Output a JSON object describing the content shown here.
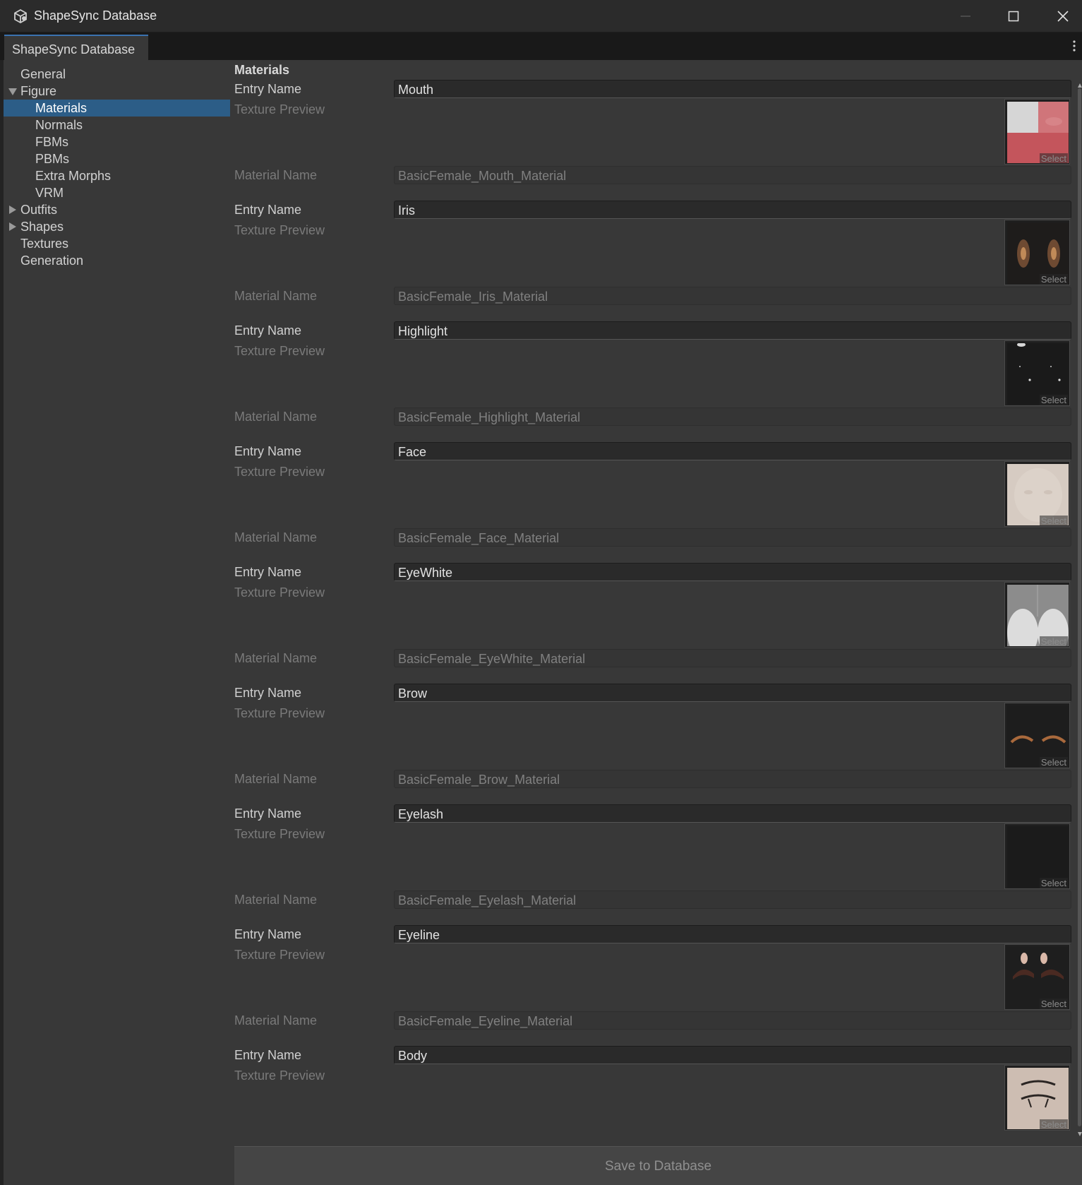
{
  "window": {
    "title": "ShapeSync Database",
    "icon": "unity-cube-icon"
  },
  "tab": {
    "label": "ShapeSync Database"
  },
  "sidebar": {
    "items": [
      {
        "label": "General"
      },
      {
        "label": "Figure",
        "expanded": true
      },
      {
        "label": "Materials",
        "selected": true
      },
      {
        "label": "Normals"
      },
      {
        "label": "FBMs"
      },
      {
        "label": "PBMs"
      },
      {
        "label": "Extra Morphs"
      },
      {
        "label": "VRM"
      },
      {
        "label": "Outfits",
        "expanded": false
      },
      {
        "label": "Shapes",
        "expanded": false
      },
      {
        "label": "Textures"
      },
      {
        "label": "Generation"
      }
    ]
  },
  "main": {
    "section_title": "Materials",
    "labels": {
      "entry_name": "Entry Name",
      "texture_preview": "Texture Preview",
      "material_name": "Material Name",
      "select": "Select"
    },
    "entries": [
      {
        "entry_name": "Mouth",
        "material_name": "BasicFemale_Mouth_Material"
      },
      {
        "entry_name": "Iris",
        "material_name": "BasicFemale_Iris_Material"
      },
      {
        "entry_name": "Highlight",
        "material_name": "BasicFemale_Highlight_Material"
      },
      {
        "entry_name": "Face",
        "material_name": "BasicFemale_Face_Material"
      },
      {
        "entry_name": "EyeWhite",
        "material_name": "BasicFemale_EyeWhite_Material"
      },
      {
        "entry_name": "Brow",
        "material_name": "BasicFemale_Brow_Material"
      },
      {
        "entry_name": "Eyelash",
        "material_name": "BasicFemale_Eyelash_Material"
      },
      {
        "entry_name": "Eyeline",
        "material_name": "BasicFemale_Eyeline_Material"
      },
      {
        "entry_name": "Body"
      }
    ],
    "save_button": "Save to Database"
  }
}
